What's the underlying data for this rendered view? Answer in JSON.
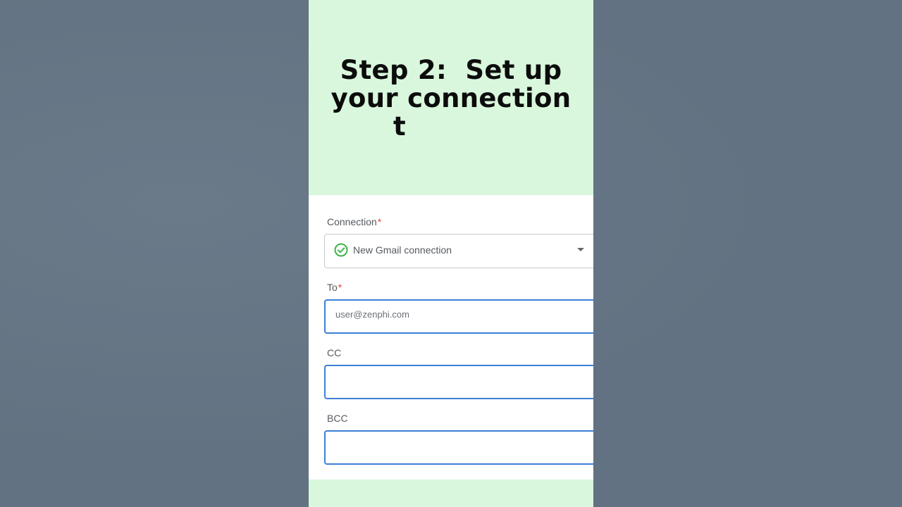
{
  "headline": {
    "line1": "Step 2:  Set up",
    "line2": "your connection",
    "line3": "t"
  },
  "form": {
    "connection": {
      "label": "Connection",
      "required_mark": "*",
      "value": "New Gmail connection",
      "status_icon": "check-circle-icon",
      "status_color": "#3db54a"
    },
    "to": {
      "label": "To",
      "required_mark": "*",
      "value": "user@zenphi.com"
    },
    "cc": {
      "label": "CC",
      "value": ""
    },
    "bcc": {
      "label": "BCC",
      "value": ""
    }
  },
  "colors": {
    "panel_bg": "#d9f7dc",
    "outer_bg": "#627282",
    "input_border": "#3d7fd6",
    "required": "#e0443a"
  }
}
